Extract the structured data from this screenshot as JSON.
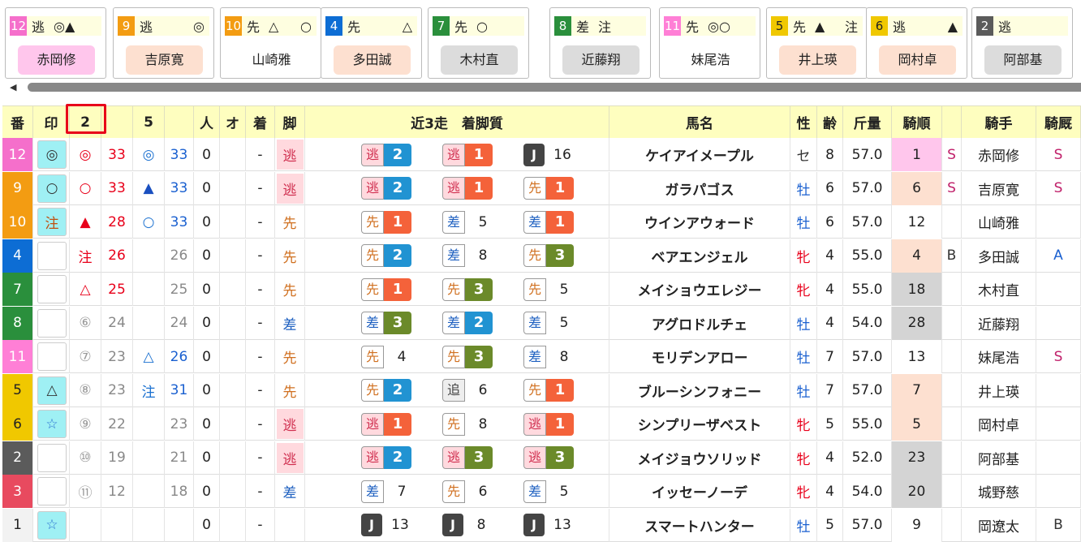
{
  "colors": {
    "waku": [
      "#f56fcb",
      "#f39c12",
      "#f39c12",
      "#0d6dd4",
      "#2a8f3c",
      "#2a8f3c",
      "#ff7fd6",
      "#f0c800",
      "#f0c800",
      "#5b5b5b",
      "#e84a5f",
      "#f2f2f2"
    ],
    "leg": {
      "逃": "#ffd9de",
      "先": "#ffffff",
      "差": "#ffffff",
      "追": "#ffffff"
    },
    "leg_text": {
      "逃": "#d03050",
      "先": "#d07020",
      "差": "#1e60c0",
      "追": "#444444"
    },
    "num_badge": {
      "1": "#f4623a",
      "2": "#2193d2",
      "3": "#6b8a2a"
    },
    "accent_red": "#e8001a"
  },
  "cards": [
    {
      "num": "12",
      "numcolor": "#f56fcb",
      "style": "逃",
      "m1": "◎▲",
      "m2": "",
      "jockey": "赤岡修",
      "jbg": "#ffc6ec"
    },
    {
      "num": "9",
      "numcolor": "#f39c12",
      "style": "逃",
      "m1": "",
      "m2": "◎",
      "jockey": "吉原寛",
      "jbg": "#fde0d0"
    },
    {
      "num": "10",
      "numcolor": "#f39c12",
      "style": "先",
      "m1": "△",
      "m2": "○",
      "jockey": "山崎雅",
      "jbg": "#ffffff"
    },
    {
      "num": "4",
      "numcolor": "#0d6dd4",
      "style": "先",
      "m1": "",
      "m2": "△",
      "jockey": "多田誠",
      "jbg": "#fde0d0"
    },
    {
      "num": "7",
      "numcolor": "#2a8f3c",
      "style": "先",
      "m1": "○",
      "m2": "",
      "jockey": "木村直",
      "jbg": "#dcdcdc"
    },
    {
      "num": "8",
      "numcolor": "#2a8f3c",
      "style": "差",
      "m1": "注",
      "m2": "",
      "jockey": "近藤翔",
      "jbg": "#dcdcdc"
    },
    {
      "num": "11",
      "numcolor": "#ff7fd6",
      "style": "先",
      "m1": "◎○",
      "m2": "",
      "jockey": "妹尾浩",
      "jbg": "#ffffff"
    },
    {
      "num": "5",
      "numcolor": "#f0c800",
      "style": "先",
      "m1": "▲",
      "m2": "注",
      "jockey": "井上瑛",
      "jbg": "#fde0d0"
    },
    {
      "num": "6",
      "numcolor": "#f0c800",
      "style": "逃",
      "m1": "",
      "m2": "▲",
      "jockey": "岡村卓",
      "jbg": "#fde0d0"
    },
    {
      "num": "2",
      "numcolor": "#5b5b5b",
      "style": "逃",
      "m1": "",
      "m2": "",
      "jockey": "阿部基",
      "jbg": "#dcdcdc"
    }
  ],
  "headers": [
    "番",
    "印",
    "2",
    "",
    "5",
    "",
    "人",
    "オ",
    "着",
    "脚",
    "近3走　着脚質",
    "馬名",
    "性",
    "齢",
    "斤量",
    "騎順",
    "",
    "騎手",
    "騎厩"
  ],
  "rows": [
    {
      "num": "12",
      "mark": "◎",
      "m2": "◎",
      "v2": "33",
      "m5": "◎",
      "v5": "33",
      "pop": "0",
      "odds": "",
      "fin": "-",
      "leg": "逃",
      "r": [
        [
          "逃",
          "2"
        ],
        [
          "逃",
          "1"
        ],
        [
          "J",
          "16"
        ]
      ],
      "name": "ケイアイメープル",
      "sex": "セ",
      "age": "8",
      "kin": "57.0",
      "jr": "1",
      "jrbg": "#ffc6ec",
      "s1": "S",
      "jockey": "赤岡修",
      "s2": "S"
    },
    {
      "num": "9",
      "mark": "○",
      "m2": "○",
      "v2": "33",
      "m5": "▲",
      "v5": "33",
      "pop": "0",
      "odds": "",
      "fin": "-",
      "leg": "逃",
      "r": [
        [
          "逃",
          "2"
        ],
        [
          "逃",
          "1"
        ],
        [
          "先",
          "1"
        ]
      ],
      "name": "ガラパゴス",
      "sex": "牡",
      "age": "6",
      "kin": "57.0",
      "jr": "6",
      "jrbg": "#fde0d0",
      "s1": "S",
      "jockey": "吉原寛",
      "s2": "S"
    },
    {
      "num": "10",
      "mark": "注",
      "m2": "▲",
      "v2": "28",
      "m5": "○",
      "v5": "33",
      "pop": "0",
      "odds": "",
      "fin": "-",
      "leg": "先",
      "r": [
        [
          "先",
          "1"
        ],
        [
          "差",
          "5"
        ],
        [
          "差",
          "1"
        ]
      ],
      "name": "ウインアウォード",
      "sex": "牡",
      "age": "6",
      "kin": "57.0",
      "jr": "12",
      "jrbg": "#ffffff",
      "s1": "",
      "jockey": "山崎雅",
      "s2": ""
    },
    {
      "num": "4",
      "mark": "",
      "m2": "注",
      "v2": "26",
      "m5": "",
      "v5": "26",
      "pop": "0",
      "odds": "",
      "fin": "-",
      "leg": "先",
      "r": [
        [
          "先",
          "2"
        ],
        [
          "差",
          "8"
        ],
        [
          "先",
          "3"
        ]
      ],
      "name": "ベアエンジェル",
      "sex": "牝",
      "age": "4",
      "kin": "55.0",
      "jr": "4",
      "jrbg": "#fde0d0",
      "s1": "B",
      "jockey": "多田誠",
      "s2": "A"
    },
    {
      "num": "7",
      "mark": "",
      "m2": "△",
      "v2": "25",
      "m5": "",
      "v5": "25",
      "pop": "0",
      "odds": "",
      "fin": "-",
      "leg": "先",
      "r": [
        [
          "先",
          "1"
        ],
        [
          "先",
          "3"
        ],
        [
          "先",
          "5"
        ]
      ],
      "name": "メイショウエレジー",
      "sex": "牝",
      "age": "4",
      "kin": "55.0",
      "jr": "18",
      "jrbg": "#d4d4d4",
      "s1": "",
      "jockey": "木村直",
      "s2": ""
    },
    {
      "num": "8",
      "mark": "",
      "m2": "⑥",
      "v2": "24",
      "m5": "",
      "v5": "24",
      "pop": "0",
      "odds": "",
      "fin": "-",
      "leg": "差",
      "r": [
        [
          "差",
          "3"
        ],
        [
          "差",
          "2"
        ],
        [
          "差",
          "5"
        ]
      ],
      "name": "アグロドルチェ",
      "sex": "牡",
      "age": "4",
      "kin": "54.0",
      "jr": "28",
      "jrbg": "#d4d4d4",
      "s1": "",
      "jockey": "近藤翔",
      "s2": ""
    },
    {
      "num": "11",
      "mark": "",
      "m2": "⑦",
      "v2": "23",
      "m5": "△",
      "v5": "26",
      "pop": "0",
      "odds": "",
      "fin": "-",
      "leg": "先",
      "r": [
        [
          "先",
          "4"
        ],
        [
          "先",
          "3"
        ],
        [
          "差",
          "8"
        ]
      ],
      "name": "モリデンアロー",
      "sex": "牡",
      "age": "7",
      "kin": "57.0",
      "jr": "13",
      "jrbg": "#ffffff",
      "s1": "",
      "jockey": "妹尾浩",
      "s2": "S"
    },
    {
      "num": "5",
      "mark": "△",
      "m2": "⑧",
      "v2": "23",
      "m5": "注",
      "v5": "31",
      "pop": "0",
      "odds": "",
      "fin": "-",
      "leg": "先",
      "r": [
        [
          "先",
          "2"
        ],
        [
          "追",
          "6"
        ],
        [
          "先",
          "1"
        ]
      ],
      "name": "ブルーシンフォニー",
      "sex": "牡",
      "age": "7",
      "kin": "57.0",
      "jr": "7",
      "jrbg": "#fde0d0",
      "s1": "",
      "jockey": "井上瑛",
      "s2": ""
    },
    {
      "num": "6",
      "mark": "☆",
      "m2": "⑨",
      "v2": "22",
      "m5": "",
      "v5": "23",
      "pop": "0",
      "odds": "",
      "fin": "-",
      "leg": "逃",
      "r": [
        [
          "逃",
          "1"
        ],
        [
          "先",
          "8"
        ],
        [
          "逃",
          "1"
        ]
      ],
      "name": "シンプリーザベスト",
      "sex": "牝",
      "age": "5",
      "kin": "55.0",
      "jr": "5",
      "jrbg": "#fde0d0",
      "s1": "",
      "jockey": "岡村卓",
      "s2": ""
    },
    {
      "num": "2",
      "mark": "",
      "m2": "⑩",
      "v2": "19",
      "m5": "",
      "v5": "21",
      "pop": "0",
      "odds": "",
      "fin": "-",
      "leg": "逃",
      "r": [
        [
          "逃",
          "2"
        ],
        [
          "逃",
          "3"
        ],
        [
          "逃",
          "3"
        ]
      ],
      "name": "メイジョウソリッド",
      "sex": "牝",
      "age": "4",
      "kin": "52.0",
      "jr": "23",
      "jrbg": "#d4d4d4",
      "s1": "",
      "jockey": "阿部基",
      "s2": ""
    },
    {
      "num": "3",
      "mark": "",
      "m2": "⑪",
      "v2": "12",
      "m5": "",
      "v5": "18",
      "pop": "0",
      "odds": "",
      "fin": "-",
      "leg": "差",
      "r": [
        [
          "差",
          "7"
        ],
        [
          "先",
          "6"
        ],
        [
          "差",
          "5"
        ]
      ],
      "name": "イッセーノーデ",
      "sex": "牝",
      "age": "4",
      "kin": "54.0",
      "jr": "20",
      "jrbg": "#d4d4d4",
      "s1": "",
      "jockey": "城野慈",
      "s2": ""
    },
    {
      "num": "1",
      "mark": "☆",
      "m2": "",
      "v2": "",
      "m5": "",
      "v5": "",
      "pop": "0",
      "odds": "",
      "fin": "-",
      "leg": "",
      "r": [
        [
          "J",
          "13"
        ],
        [
          "J",
          "8"
        ],
        [
          "J",
          "13"
        ]
      ],
      "name": "スマートハンター",
      "sex": "牡",
      "age": "5",
      "kin": "57.0",
      "jr": "9",
      "jrbg": "#ffffff",
      "s1": "",
      "jockey": "岡遼太",
      "s2": "B"
    }
  ]
}
